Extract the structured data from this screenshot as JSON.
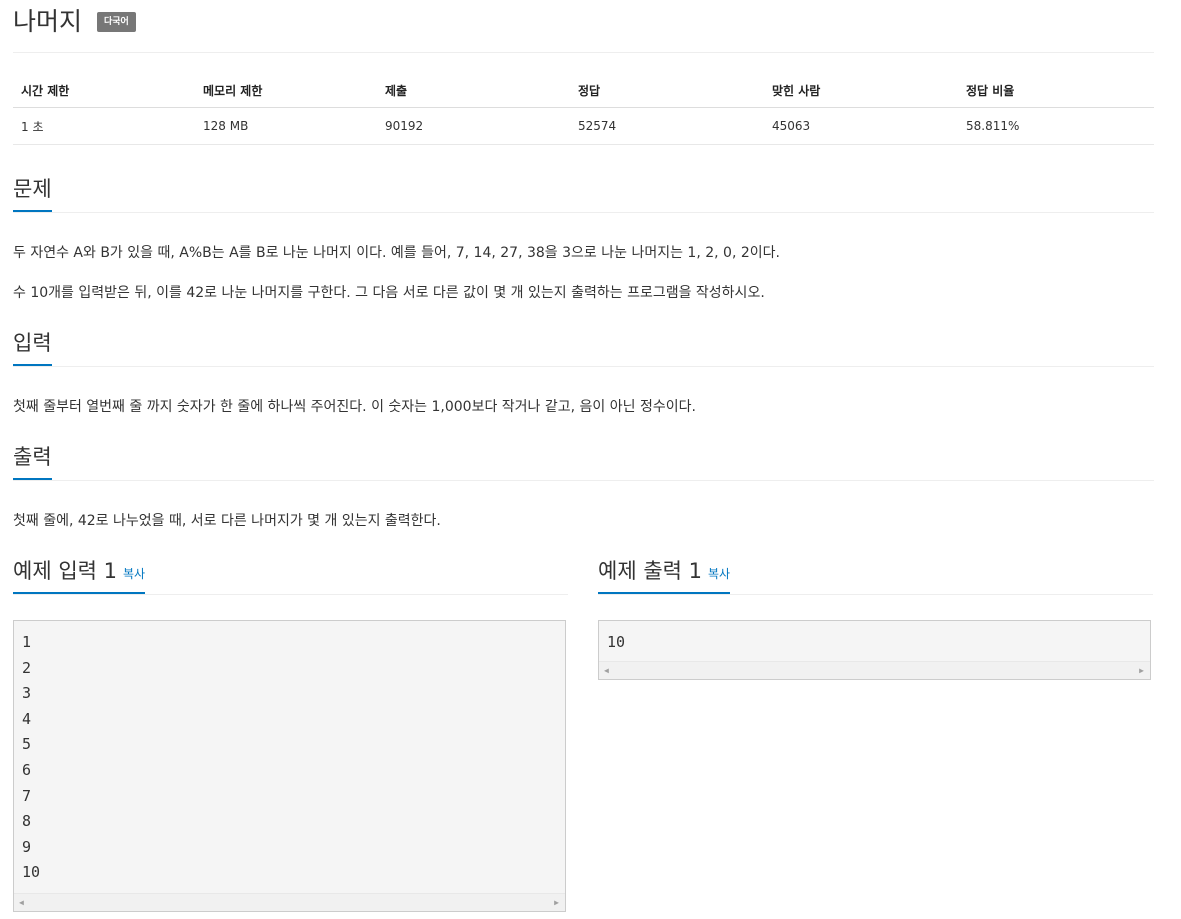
{
  "problem": {
    "title": "나머지",
    "lang_badge": "다국어"
  },
  "info_table": {
    "headers": [
      "시간 제한",
      "메모리 제한",
      "제출",
      "정답",
      "맞힌 사람",
      "정답 비율"
    ],
    "values": [
      "1 초",
      "128 MB",
      "90192",
      "52574",
      "45063",
      "58.811%"
    ]
  },
  "sections": {
    "description": {
      "heading": "문제",
      "paragraphs": [
        "두 자연수 A와 B가 있을 때, A%B는 A를 B로 나눈 나머지 이다. 예를 들어, 7, 14, 27, 38을 3으로 나눈 나머지는 1, 2, 0, 2이다.",
        "수 10개를 입력받은 뒤, 이를 42로 나눈 나머지를 구한다. 그 다음 서로 다른 값이 몇 개 있는지 출력하는 프로그램을 작성하시오."
      ]
    },
    "input": {
      "heading": "입력",
      "text": "첫째 줄부터 열번째 줄 까지 숫자가 한 줄에 하나씩 주어진다. 이 숫자는 1,000보다 작거나 같고, 음이 아닌 정수이다."
    },
    "output": {
      "heading": "출력",
      "text": "첫째 줄에, 42로 나누었을 때, 서로 다른 나머지가 몇 개 있는지 출력한다."
    }
  },
  "samples": {
    "input": {
      "heading": "예제 입력 1",
      "copy_label": "복사",
      "lines": [
        "1",
        "2",
        "3",
        "4",
        "5",
        "6",
        "7",
        "8",
        "9",
        "10"
      ]
    },
    "output": {
      "heading": "예제 출력 1",
      "copy_label": "복사",
      "lines": [
        "10"
      ]
    }
  },
  "colors": {
    "accent": "#0076c0",
    "badge": "#777777",
    "pre_bg": "#f5f5f5"
  }
}
